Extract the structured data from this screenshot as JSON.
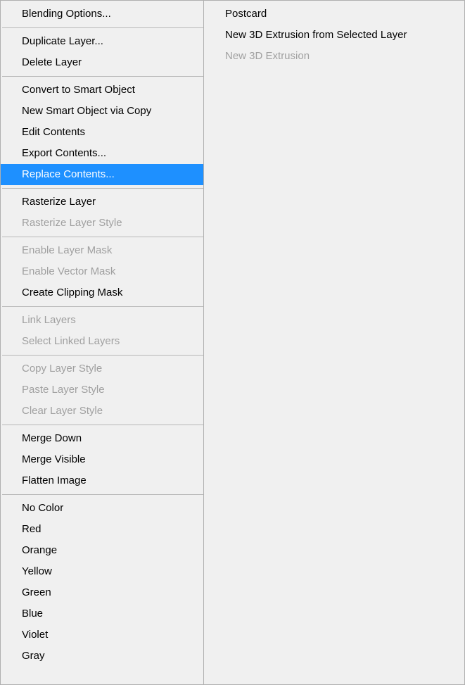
{
  "leftMenu": {
    "group1": [
      {
        "label": "Blending Options...",
        "disabled": false
      }
    ],
    "group2": [
      {
        "label": "Duplicate Layer...",
        "disabled": false
      },
      {
        "label": "Delete Layer",
        "disabled": false
      }
    ],
    "group3": [
      {
        "label": "Convert to Smart Object",
        "disabled": false
      },
      {
        "label": "New Smart Object via Copy",
        "disabled": false
      },
      {
        "label": "Edit Contents",
        "disabled": false
      },
      {
        "label": "Export Contents...",
        "disabled": false
      },
      {
        "label": "Replace Contents...",
        "disabled": false,
        "highlighted": true
      }
    ],
    "group4": [
      {
        "label": "Rasterize Layer",
        "disabled": false
      },
      {
        "label": "Rasterize Layer Style",
        "disabled": true
      }
    ],
    "group5": [
      {
        "label": "Enable Layer Mask",
        "disabled": true
      },
      {
        "label": "Enable Vector Mask",
        "disabled": true
      },
      {
        "label": "Create Clipping Mask",
        "disabled": false
      }
    ],
    "group6": [
      {
        "label": "Link Layers",
        "disabled": true
      },
      {
        "label": "Select Linked Layers",
        "disabled": true
      }
    ],
    "group7": [
      {
        "label": "Copy Layer Style",
        "disabled": true
      },
      {
        "label": "Paste Layer Style",
        "disabled": true
      },
      {
        "label": "Clear Layer Style",
        "disabled": true
      }
    ],
    "group8": [
      {
        "label": "Merge Down",
        "disabled": false
      },
      {
        "label": "Merge Visible",
        "disabled": false
      },
      {
        "label": "Flatten Image",
        "disabled": false
      }
    ],
    "group9": [
      {
        "label": "No Color",
        "disabled": false
      },
      {
        "label": "Red",
        "disabled": false
      },
      {
        "label": "Orange",
        "disabled": false
      },
      {
        "label": "Yellow",
        "disabled": false
      },
      {
        "label": "Green",
        "disabled": false
      },
      {
        "label": "Blue",
        "disabled": false
      },
      {
        "label": "Violet",
        "disabled": false
      },
      {
        "label": "Gray",
        "disabled": false
      }
    ]
  },
  "rightMenu": {
    "group1": [
      {
        "label": "Postcard",
        "disabled": false
      },
      {
        "label": "New 3D Extrusion from Selected Layer",
        "disabled": false
      },
      {
        "label": "New 3D Extrusion",
        "disabled": true
      }
    ]
  }
}
